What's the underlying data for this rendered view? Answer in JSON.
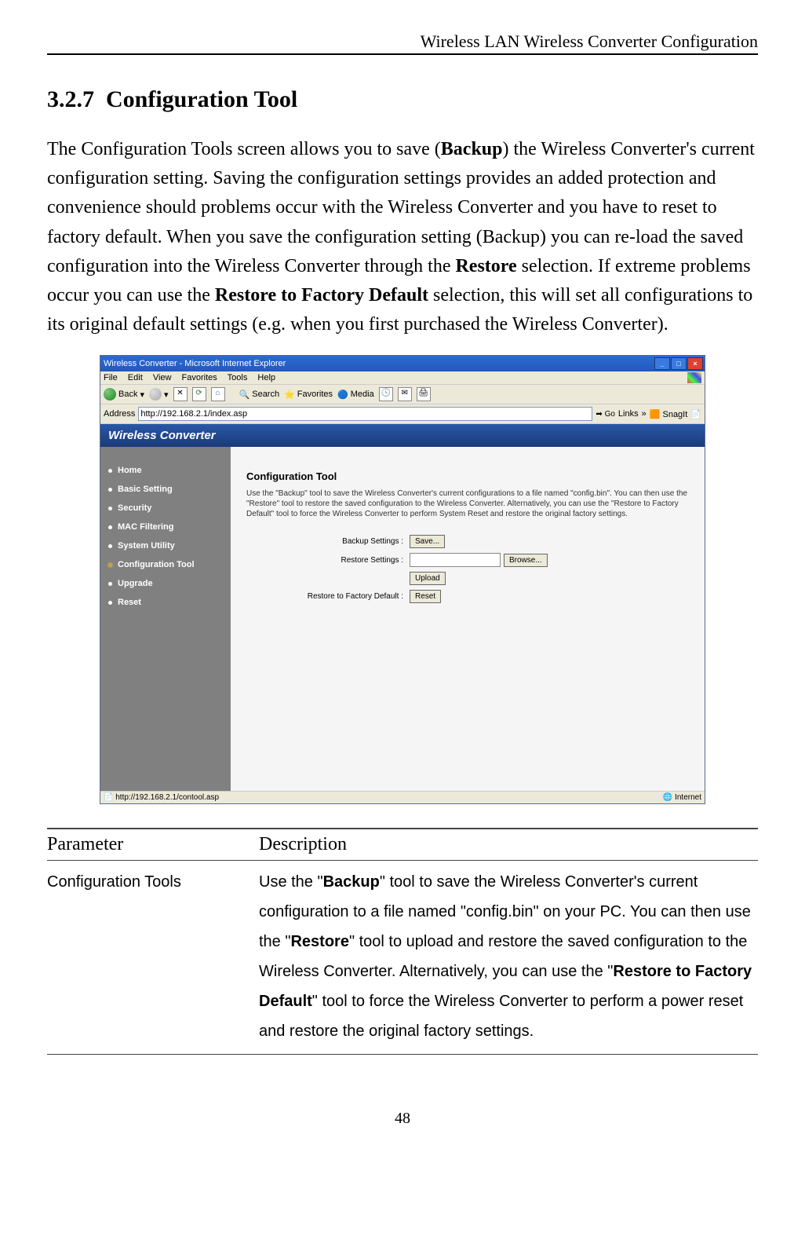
{
  "header": "Wireless LAN Wireless Converter Configuration",
  "section_number": "3.2.7",
  "section_title": "Configuration Tool",
  "body_html": "The Configuration Tools screen allows you to save (<b>Backup</b>) the Wireless Converter's current configuration setting. Saving the configuration settings provides an added protection and convenience should problems occur with the Wireless Converter and you have to reset to factory default. When you save the configuration setting (Backup) you can re-load the saved configuration into the Wireless Converter through the <b>Restore</b> selection. If extreme problems occur you can use the <b>Restore to Factory Default</b> selection, this will set all configurations to its original default settings (e.g. when you first purchased the Wireless Converter).",
  "screenshot": {
    "window_title": "Wireless Converter - Microsoft Internet Explorer",
    "menus": [
      "File",
      "Edit",
      "View",
      "Favorites",
      "Tools",
      "Help"
    ],
    "toolbar": {
      "back": "Back",
      "search": "Search",
      "favorites": "Favorites",
      "media": "Media"
    },
    "address_label": "Address",
    "address_url": "http://192.168.2.1/index.asp",
    "go": "Go",
    "links": "Links",
    "snagit": "SnagIt",
    "brand": "Wireless Converter",
    "sidebar": [
      "Home",
      "Basic Setting",
      "Security",
      "MAC Filtering",
      "System Utility",
      "Configuration Tool",
      "Upgrade",
      "Reset"
    ],
    "sidebar_active_index": 5,
    "panel_title": "Configuration Tool",
    "panel_desc": "Use the \"Backup\" tool to save the Wireless Converter's current configurations to a file named \"config.bin\". You can then use the \"Restore\" tool to restore the saved configuration to the Wireless Converter. Alternatively, you can use the \"Restore to Factory Default\" tool to force the Wireless Converter to perform System Reset and restore the original factory settings.",
    "rows": {
      "backup_label": "Backup Settings :",
      "backup_button": "Save...",
      "restore_label": "Restore Settings :",
      "restore_browse": "Browse...",
      "restore_upload": "Upload",
      "factory_label": "Restore to Factory Default :",
      "factory_button": "Reset"
    },
    "status_left": "http://192.168.2.1/contool.asp",
    "status_right": "Internet"
  },
  "table": {
    "headers": [
      "Parameter",
      "Description"
    ],
    "row_param": "Configuration Tools",
    "row_desc_html": "Use the \"<b>Backup</b>\" tool to save the Wireless Converter's current configuration to a file named \"config.bin\" on your PC. You can then use the \"<b>Restore</b>\" tool to upload and restore the saved configuration to the Wireless Converter. Alternatively, you can use the \"<b>Restore to Factory Default</b>\" tool to force the Wireless Converter to perform a power reset and restore the original factory settings."
  },
  "page_number": "48"
}
